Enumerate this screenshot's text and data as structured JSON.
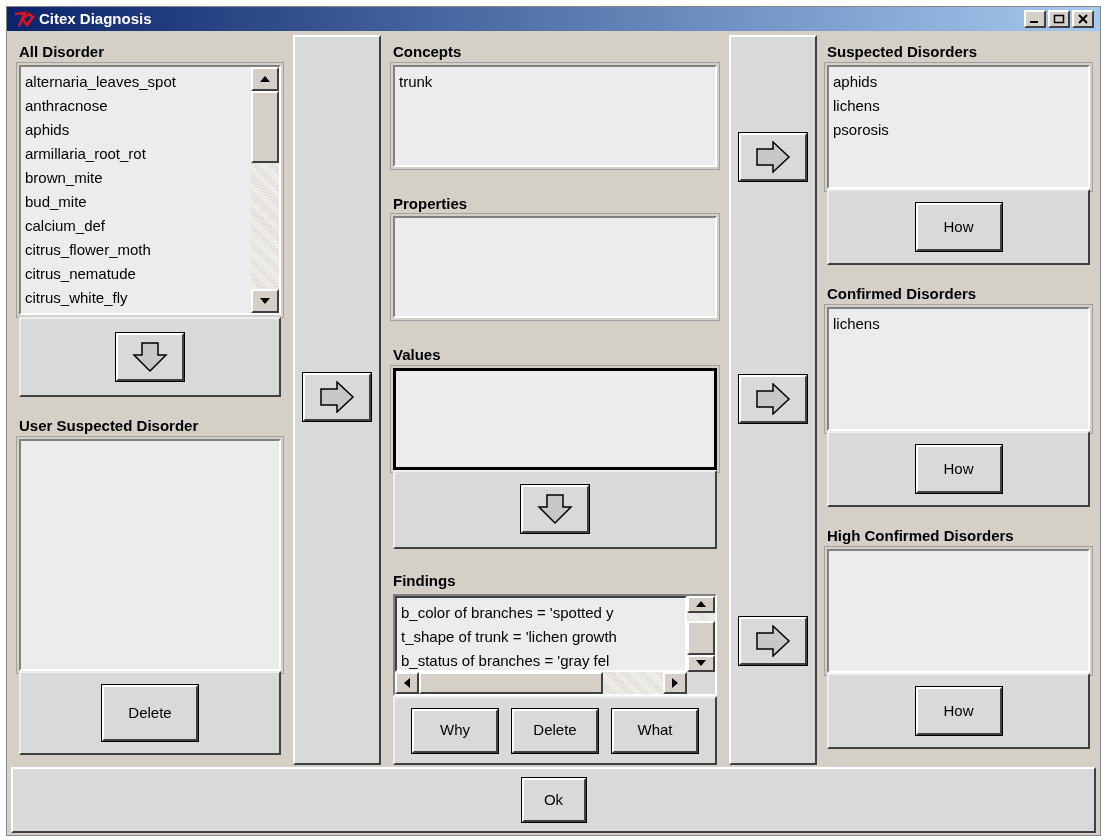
{
  "window": {
    "title": "Citex Diagnosis"
  },
  "all_disorder": {
    "label": "All Disorder",
    "items": [
      "alternaria_leaves_spot",
      "anthracnose",
      "aphids",
      "armillaria_root_rot",
      "brown_mite",
      "bud_mite",
      "calcium_def",
      "citrus_flower_moth",
      "citrus_nematude",
      "citrus_white_fly"
    ]
  },
  "user_suspected": {
    "label": "User Suspected Disorder",
    "button": "Delete"
  },
  "concepts": {
    "label": "Concepts",
    "items": [
      "trunk"
    ]
  },
  "properties": {
    "label": "Properties"
  },
  "values": {
    "label": "Values"
  },
  "findings": {
    "label": "Findings",
    "items": [
      "b_color of branches = 'spotted y",
      "t_shape of trunk = 'lichen growth",
      "b_status of branches = 'gray fel"
    ],
    "buttons": [
      "Why",
      "Delete",
      "What"
    ]
  },
  "suspected": {
    "label": "Suspected Disorders",
    "items": [
      "aphids",
      "lichens",
      "psorosis"
    ],
    "button": "How"
  },
  "confirmed": {
    "label": "Confirmed Disorders",
    "items": [
      "lichens"
    ],
    "button": "How"
  },
  "high_confirmed": {
    "label": "High Confirmed Disorders",
    "button": "How"
  },
  "ok_button": "Ok"
}
